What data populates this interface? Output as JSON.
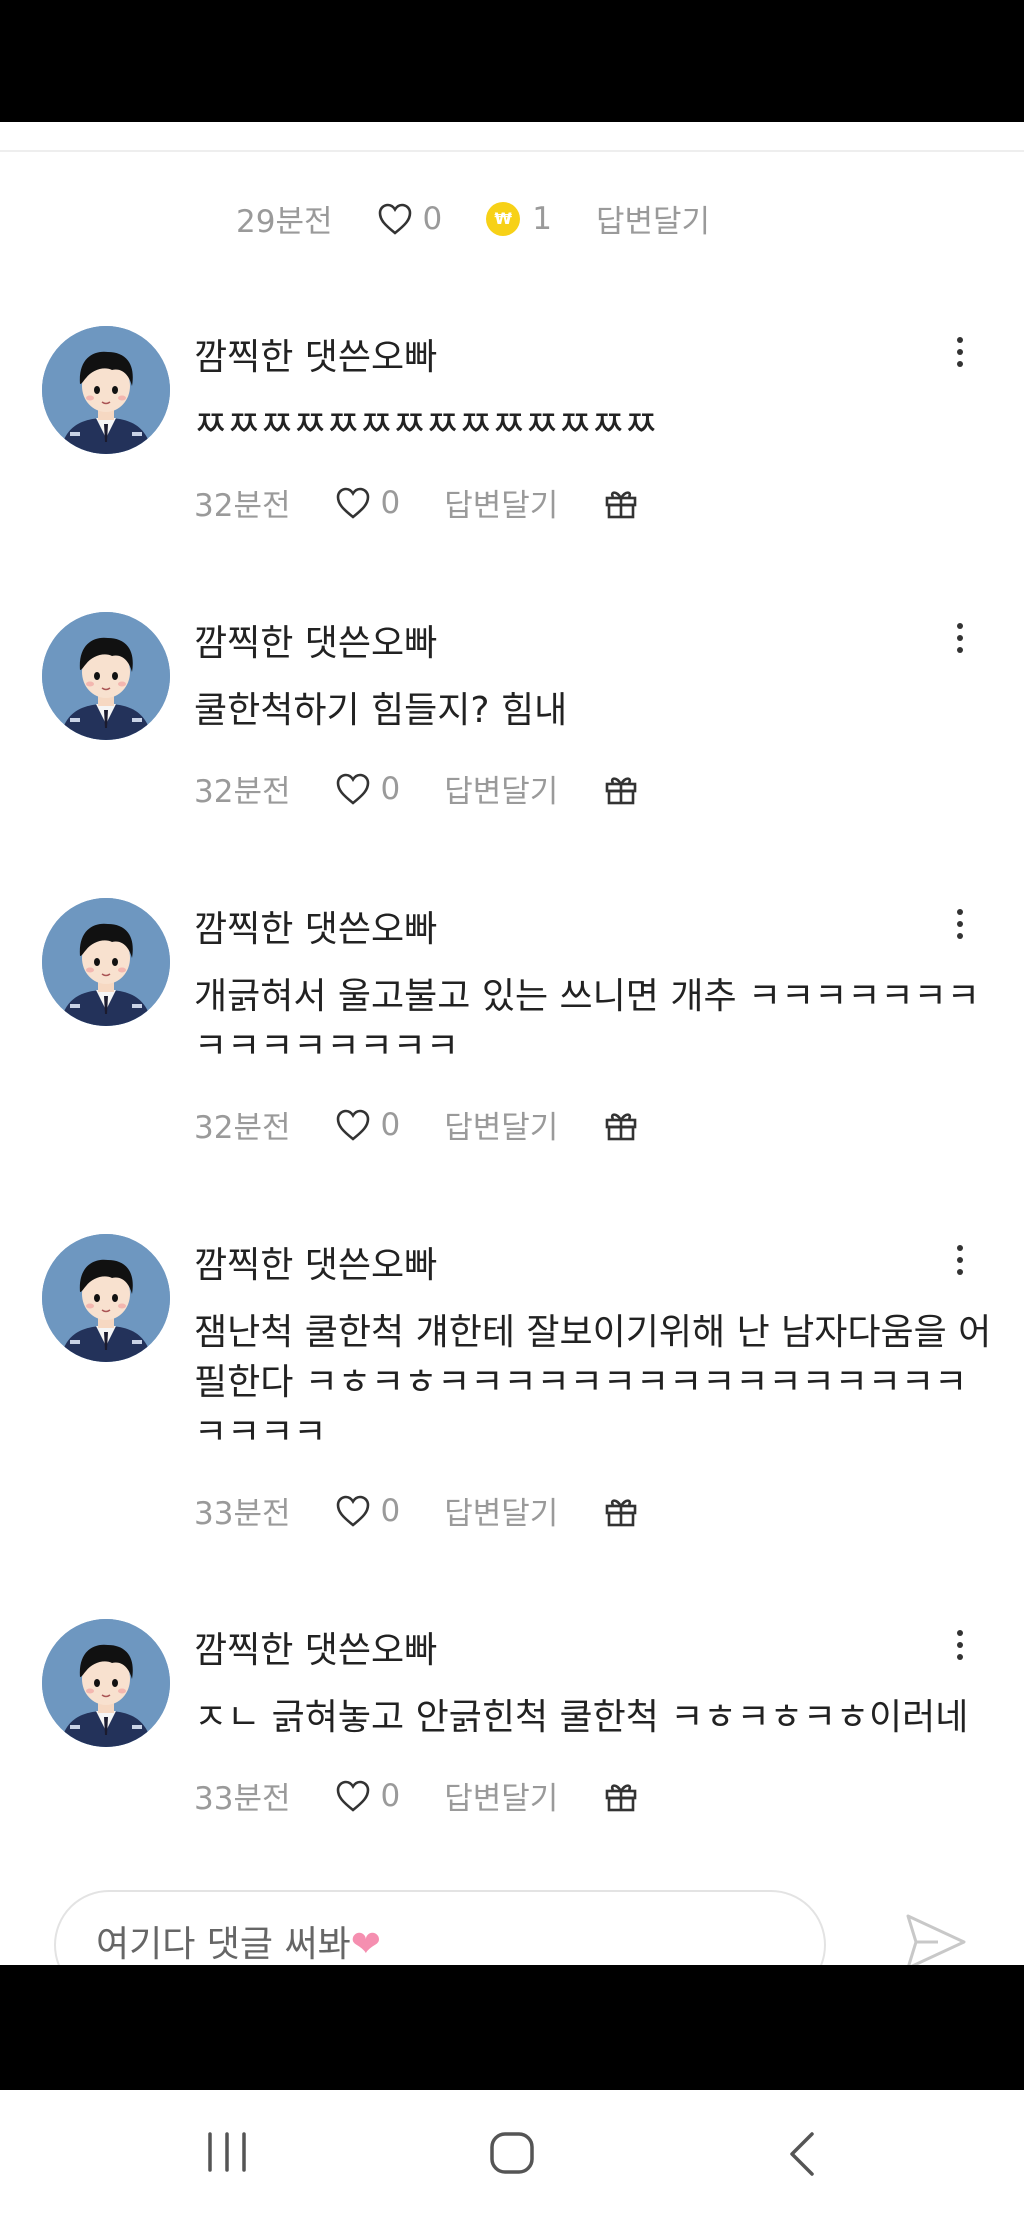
{
  "top_partial": {
    "time": "29분전",
    "likes": "0",
    "coin_count": "1",
    "reply_label": "답변달기"
  },
  "comments": [
    {
      "author": "깜찍한 댓쓴오빠",
      "text": "ㅉㅉㅉㅉㅉㅉㅉㅉㅉㅉㅉㅉㅉㅉ",
      "time": "32분전",
      "likes": "0",
      "reply_label": "답변달기"
    },
    {
      "author": "깜찍한 댓쓴오빠",
      "text": "쿨한척하기 힘들지? 힘내",
      "time": "32분전",
      "likes": "0",
      "reply_label": "답변달기"
    },
    {
      "author": "깜찍한 댓쓴오빠",
      "text": "개긁혀서 울고불고 있는 쓰니면 개추 ㅋㅋㅋㅋㅋㅋㅋㅋㅋㅋㅋㅋㅋㅋㅋ",
      "time": "32분전",
      "likes": "0",
      "reply_label": "답변달기"
    },
    {
      "author": "깜찍한 댓쓴오빠",
      "text": "잼난척 쿨한척 걔한테 잘보이기위해 난 남자다움을 어필한다 ㅋㅎㅋㅎㅋㅋㅋㅋㅋㅋㅋㅋㅋㅋㅋㅋㅋㅋㅋㅋㅋㅋㅋㅋ",
      "time": "33분전",
      "likes": "0",
      "reply_label": "답변달기"
    },
    {
      "author": "깜찍한 댓쓴오빠",
      "text": "ㅈㄴ 긁혀놓고 안긁힌척 쿨한척 ㅋㅎㅋㅎㅋㅎ이러네",
      "time": "33분전",
      "likes": "0",
      "reply_label": "답변달기"
    }
  ],
  "composer": {
    "placeholder": "여기다 댓글 써봐",
    "heart_emoji": "❤"
  },
  "colors": {
    "meta_gray": "#9a9a9a",
    "coin_yellow": "#f7d117",
    "avatar_bg": "#6e97c0"
  }
}
